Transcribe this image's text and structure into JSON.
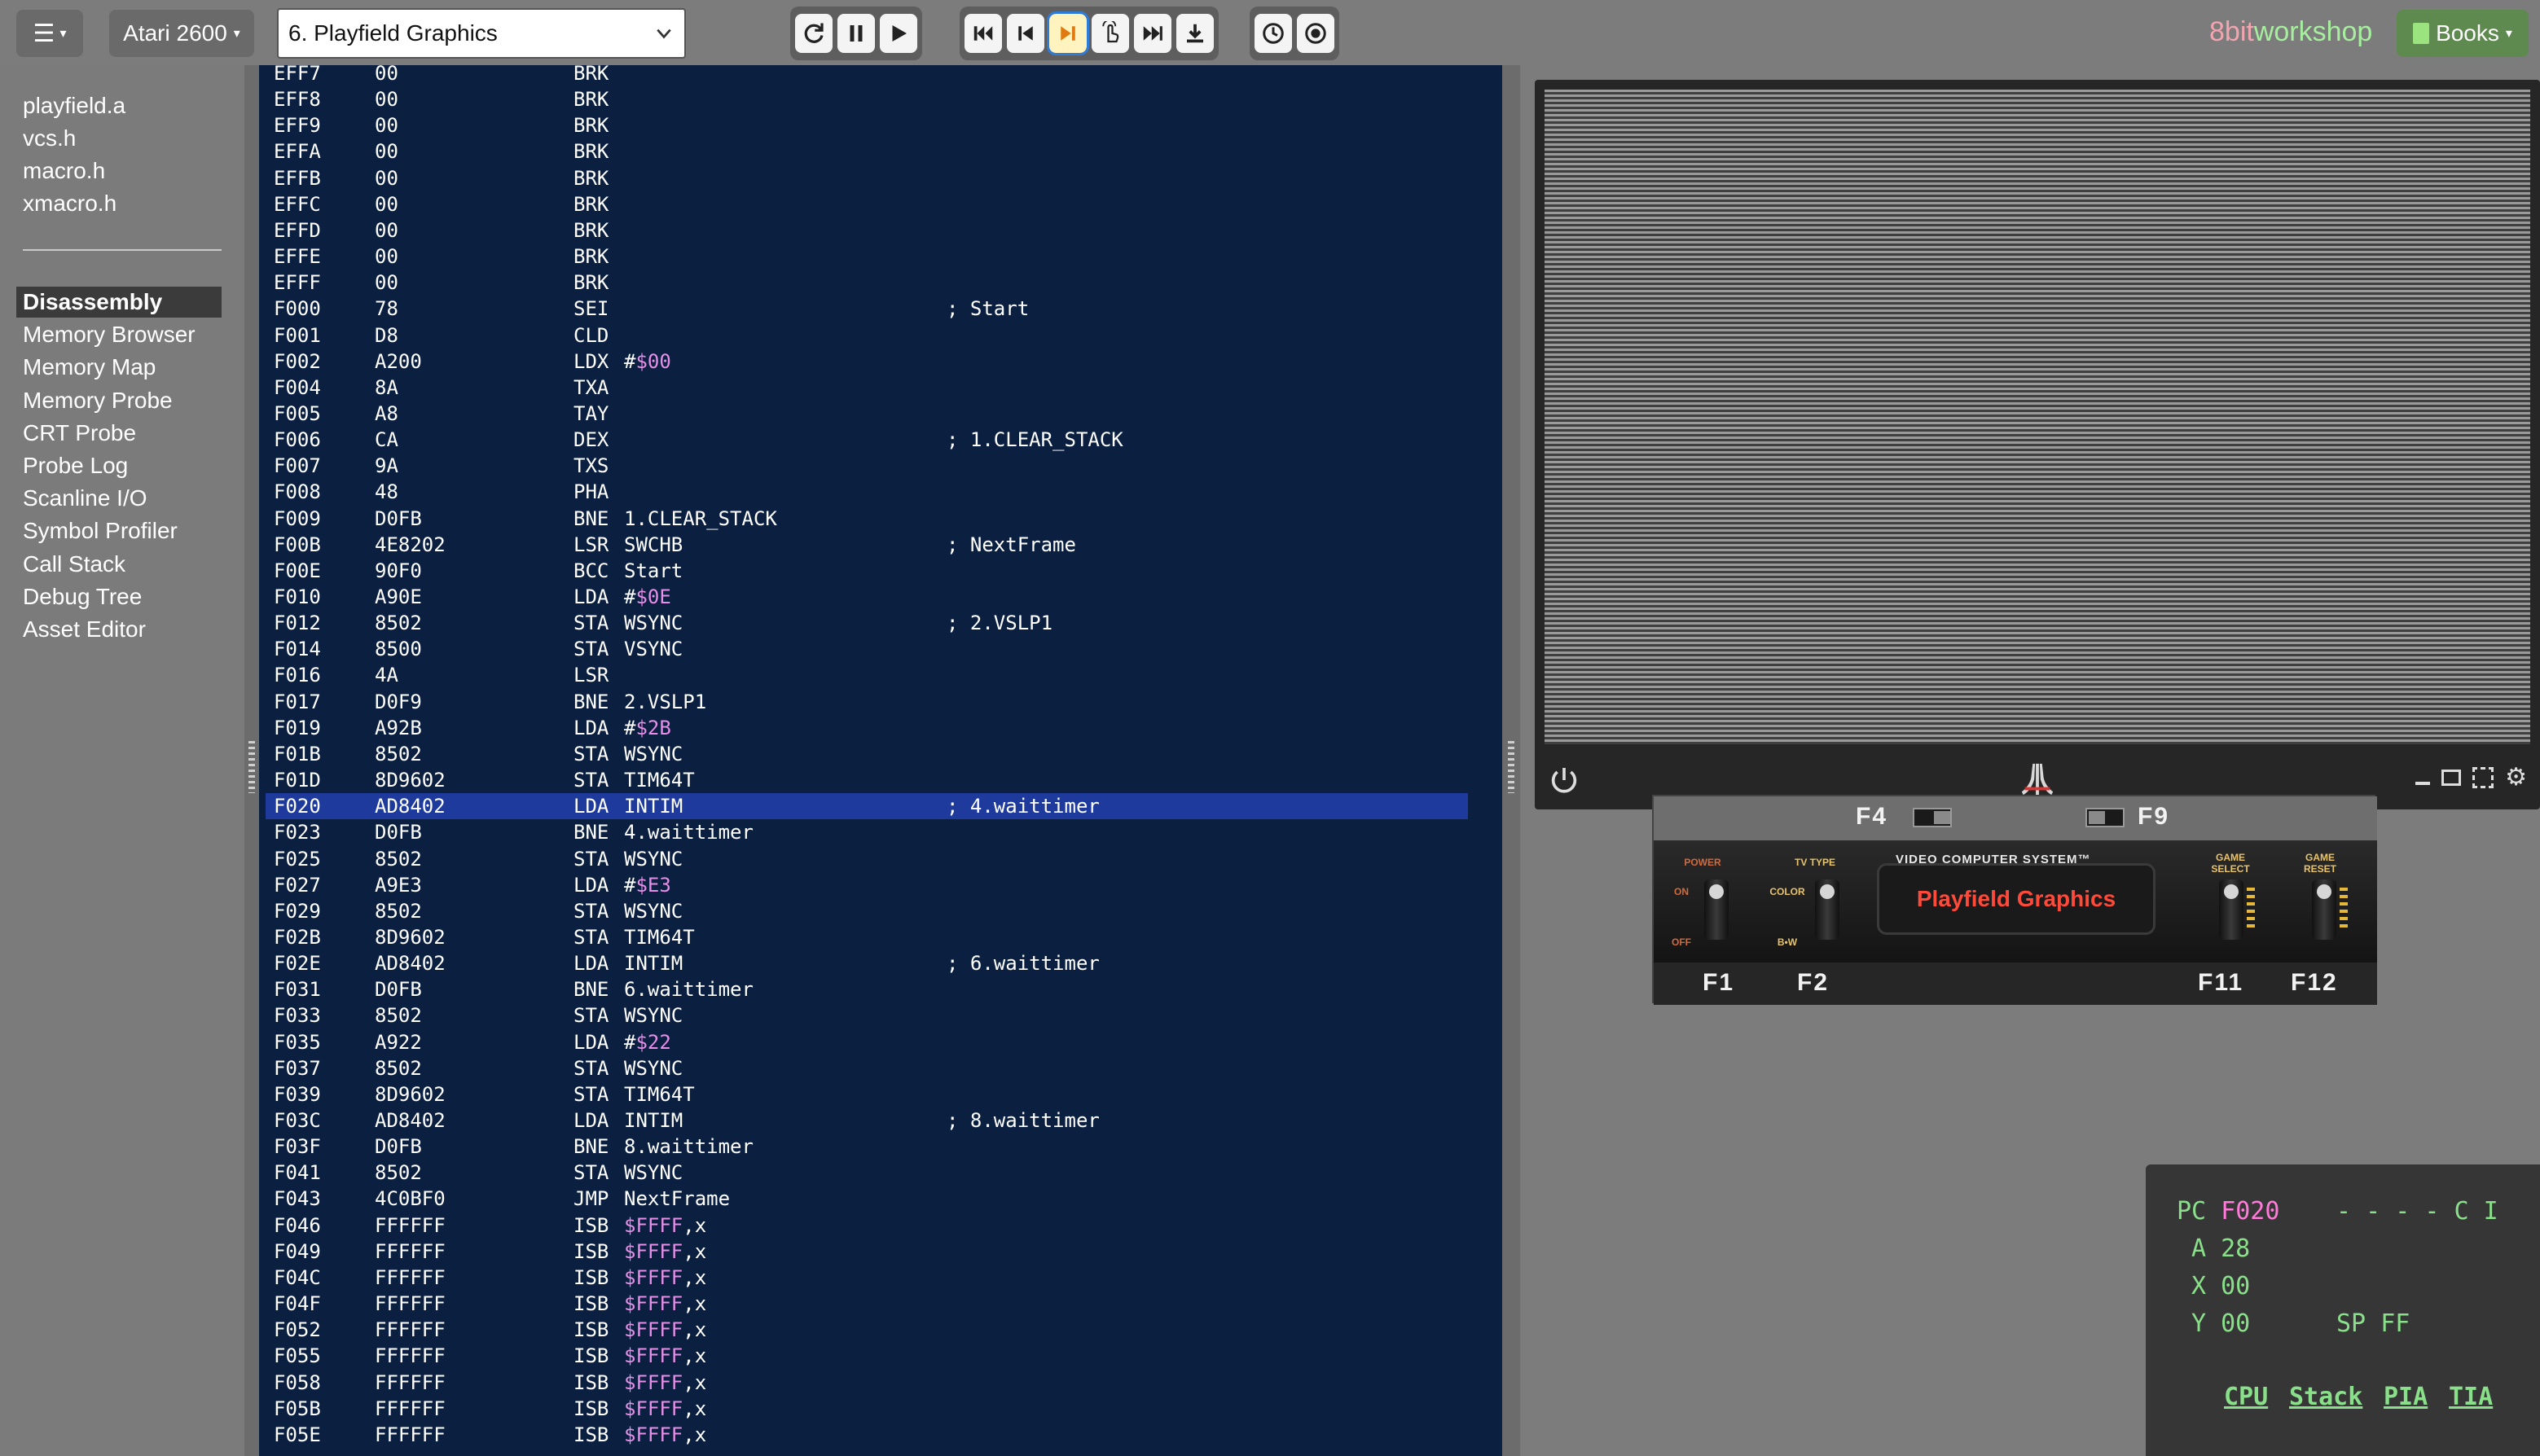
{
  "topbar": {
    "menu_icon": "hamburger-icon",
    "platform": "Atari 2600",
    "preset": "6. Playfield Graphics",
    "buttons_run": [
      "reset-icon",
      "pause-icon",
      "play-icon"
    ],
    "buttons_step": [
      "rewind-start-icon",
      "step-back-icon",
      "step-over-icon",
      "step-cursor-icon",
      "fast-forward-icon",
      "download-icon"
    ],
    "buttons_misc": [
      "clock-icon",
      "record-icon"
    ],
    "brand_a": "8bit",
    "brand_b": "workshop",
    "books": "Books"
  },
  "sidebar": {
    "files": [
      "playfield.a",
      "vcs.h",
      "macro.h",
      "xmacro.h"
    ],
    "views": [
      "Disassembly",
      "Memory Browser",
      "Memory Map",
      "Memory Probe",
      "CRT Probe",
      "Probe Log",
      "Scanline I/O",
      "Symbol Profiler",
      "Call Stack",
      "Debug Tree",
      "Asset Editor"
    ],
    "selected_view": "Disassembly"
  },
  "disassembly": {
    "highlight_index": 28,
    "rows": [
      {
        "addr": "EFF7",
        "hex": "00",
        "op": "BRK",
        "arg": "",
        "lit": "",
        "suffix": "",
        "comment": ""
      },
      {
        "addr": "EFF8",
        "hex": "00",
        "op": "BRK",
        "arg": "",
        "lit": "",
        "suffix": "",
        "comment": ""
      },
      {
        "addr": "EFF9",
        "hex": "00",
        "op": "BRK",
        "arg": "",
        "lit": "",
        "suffix": "",
        "comment": ""
      },
      {
        "addr": "EFFA",
        "hex": "00",
        "op": "BRK",
        "arg": "",
        "lit": "",
        "suffix": "",
        "comment": ""
      },
      {
        "addr": "EFFB",
        "hex": "00",
        "op": "BRK",
        "arg": "",
        "lit": "",
        "suffix": "",
        "comment": ""
      },
      {
        "addr": "EFFC",
        "hex": "00",
        "op": "BRK",
        "arg": "",
        "lit": "",
        "suffix": "",
        "comment": ""
      },
      {
        "addr": "EFFD",
        "hex": "00",
        "op": "BRK",
        "arg": "",
        "lit": "",
        "suffix": "",
        "comment": ""
      },
      {
        "addr": "EFFE",
        "hex": "00",
        "op": "BRK",
        "arg": "",
        "lit": "",
        "suffix": "",
        "comment": ""
      },
      {
        "addr": "EFFF",
        "hex": "00",
        "op": "BRK",
        "arg": "",
        "lit": "",
        "suffix": "",
        "comment": ""
      },
      {
        "addr": "F000",
        "hex": "78",
        "op": "SEI",
        "arg": "",
        "lit": "",
        "suffix": "",
        "comment": "; Start"
      },
      {
        "addr": "F001",
        "hex": "D8",
        "op": "CLD",
        "arg": "",
        "lit": "",
        "suffix": "",
        "comment": ""
      },
      {
        "addr": "F002",
        "hex": "A200",
        "op": "LDX",
        "arg": "#",
        "lit": "$00",
        "suffix": "",
        "comment": ""
      },
      {
        "addr": "F004",
        "hex": "8A",
        "op": "TXA",
        "arg": "",
        "lit": "",
        "suffix": "",
        "comment": ""
      },
      {
        "addr": "F005",
        "hex": "A8",
        "op": "TAY",
        "arg": "",
        "lit": "",
        "suffix": "",
        "comment": ""
      },
      {
        "addr": "F006",
        "hex": "CA",
        "op": "DEX",
        "arg": "",
        "lit": "",
        "suffix": "",
        "comment": "; 1.CLEAR_STACK"
      },
      {
        "addr": "F007",
        "hex": "9A",
        "op": "TXS",
        "arg": "",
        "lit": "",
        "suffix": "",
        "comment": ""
      },
      {
        "addr": "F008",
        "hex": "48",
        "op": "PHA",
        "arg": "",
        "lit": "",
        "suffix": "",
        "comment": ""
      },
      {
        "addr": "F009",
        "hex": "D0FB",
        "op": "BNE",
        "arg": "1.CLEAR_STACK",
        "lit": "",
        "suffix": "",
        "comment": ""
      },
      {
        "addr": "F00B",
        "hex": "4E8202",
        "op": "LSR",
        "arg": "SWCHB",
        "lit": "",
        "suffix": "",
        "comment": "; NextFrame"
      },
      {
        "addr": "F00E",
        "hex": "90F0",
        "op": "BCC",
        "arg": "Start",
        "lit": "",
        "suffix": "",
        "comment": ""
      },
      {
        "addr": "F010",
        "hex": "A90E",
        "op": "LDA",
        "arg": "#",
        "lit": "$0E",
        "suffix": "",
        "comment": ""
      },
      {
        "addr": "F012",
        "hex": "8502",
        "op": "STA",
        "arg": "WSYNC",
        "lit": "",
        "suffix": "",
        "comment": "; 2.VSLP1"
      },
      {
        "addr": "F014",
        "hex": "8500",
        "op": "STA",
        "arg": "VSYNC",
        "lit": "",
        "suffix": "",
        "comment": ""
      },
      {
        "addr": "F016",
        "hex": "4A",
        "op": "LSR",
        "arg": "",
        "lit": "",
        "suffix": "",
        "comment": ""
      },
      {
        "addr": "F017",
        "hex": "D0F9",
        "op": "BNE",
        "arg": "2.VSLP1",
        "lit": "",
        "suffix": "",
        "comment": ""
      },
      {
        "addr": "F019",
        "hex": "A92B",
        "op": "LDA",
        "arg": "#",
        "lit": "$2B",
        "suffix": "",
        "comment": ""
      },
      {
        "addr": "F01B",
        "hex": "8502",
        "op": "STA",
        "arg": "WSYNC",
        "lit": "",
        "suffix": "",
        "comment": ""
      },
      {
        "addr": "F01D",
        "hex": "8D9602",
        "op": "STA",
        "arg": "TIM64T",
        "lit": "",
        "suffix": "",
        "comment": ""
      },
      {
        "addr": "F020",
        "hex": "AD8402",
        "op": "LDA",
        "arg": "INTIM",
        "lit": "",
        "suffix": "",
        "comment": "; 4.waittimer"
      },
      {
        "addr": "F023",
        "hex": "D0FB",
        "op": "BNE",
        "arg": "4.waittimer",
        "lit": "",
        "suffix": "",
        "comment": ""
      },
      {
        "addr": "F025",
        "hex": "8502",
        "op": "STA",
        "arg": "WSYNC",
        "lit": "",
        "suffix": "",
        "comment": ""
      },
      {
        "addr": "F027",
        "hex": "A9E3",
        "op": "LDA",
        "arg": "#",
        "lit": "$E3",
        "suffix": "",
        "comment": ""
      },
      {
        "addr": "F029",
        "hex": "8502",
        "op": "STA",
        "arg": "WSYNC",
        "lit": "",
        "suffix": "",
        "comment": ""
      },
      {
        "addr": "F02B",
        "hex": "8D9602",
        "op": "STA",
        "arg": "TIM64T",
        "lit": "",
        "suffix": "",
        "comment": ""
      },
      {
        "addr": "F02E",
        "hex": "AD8402",
        "op": "LDA",
        "arg": "INTIM",
        "lit": "",
        "suffix": "",
        "comment": "; 6.waittimer"
      },
      {
        "addr": "F031",
        "hex": "D0FB",
        "op": "BNE",
        "arg": "6.waittimer",
        "lit": "",
        "suffix": "",
        "comment": ""
      },
      {
        "addr": "F033",
        "hex": "8502",
        "op": "STA",
        "arg": "WSYNC",
        "lit": "",
        "suffix": "",
        "comment": ""
      },
      {
        "addr": "F035",
        "hex": "A922",
        "op": "LDA",
        "arg": "#",
        "lit": "$22",
        "suffix": "",
        "comment": ""
      },
      {
        "addr": "F037",
        "hex": "8502",
        "op": "STA",
        "arg": "WSYNC",
        "lit": "",
        "suffix": "",
        "comment": ""
      },
      {
        "addr": "F039",
        "hex": "8D9602",
        "op": "STA",
        "arg": "TIM64T",
        "lit": "",
        "suffix": "",
        "comment": ""
      },
      {
        "addr": "F03C",
        "hex": "AD8402",
        "op": "LDA",
        "arg": "INTIM",
        "lit": "",
        "suffix": "",
        "comment": "; 8.waittimer"
      },
      {
        "addr": "F03F",
        "hex": "D0FB",
        "op": "BNE",
        "arg": "8.waittimer",
        "lit": "",
        "suffix": "",
        "comment": ""
      },
      {
        "addr": "F041",
        "hex": "8502",
        "op": "STA",
        "arg": "WSYNC",
        "lit": "",
        "suffix": "",
        "comment": ""
      },
      {
        "addr": "F043",
        "hex": "4C0BF0",
        "op": "JMP",
        "arg": "NextFrame",
        "lit": "",
        "suffix": "",
        "comment": ""
      },
      {
        "addr": "F046",
        "hex": "FFFFFF",
        "op": "ISB",
        "arg": "",
        "lit": "$FFFF",
        "suffix": ",x",
        "comment": ""
      },
      {
        "addr": "F049",
        "hex": "FFFFFF",
        "op": "ISB",
        "arg": "",
        "lit": "$FFFF",
        "suffix": ",x",
        "comment": ""
      },
      {
        "addr": "F04C",
        "hex": "FFFFFF",
        "op": "ISB",
        "arg": "",
        "lit": "$FFFF",
        "suffix": ",x",
        "comment": ""
      },
      {
        "addr": "F04F",
        "hex": "FFFFFF",
        "op": "ISB",
        "arg": "",
        "lit": "$FFFF",
        "suffix": ",x",
        "comment": ""
      },
      {
        "addr": "F052",
        "hex": "FFFFFF",
        "op": "ISB",
        "arg": "",
        "lit": "$FFFF",
        "suffix": ",x",
        "comment": ""
      },
      {
        "addr": "F055",
        "hex": "FFFFFF",
        "op": "ISB",
        "arg": "",
        "lit": "$FFFF",
        "suffix": ",x",
        "comment": ""
      },
      {
        "addr": "F058",
        "hex": "FFFFFF",
        "op": "ISB",
        "arg": "",
        "lit": "$FFFF",
        "suffix": ",x",
        "comment": ""
      },
      {
        "addr": "F05B",
        "hex": "FFFFFF",
        "op": "ISB",
        "arg": "",
        "lit": "$FFFF",
        "suffix": ",x",
        "comment": ""
      },
      {
        "addr": "F05E",
        "hex": "FFFFFF",
        "op": "ISB",
        "arg": "",
        "lit": "$FFFF",
        "suffix": ",x",
        "comment": ""
      }
    ]
  },
  "emulator": {
    "screen_tools": [
      "minimize-icon",
      "window-icon",
      "fullscreen-icon",
      "gear-icon"
    ],
    "console": {
      "f4": "F4",
      "f9": "F9",
      "power_label": "POWER",
      "on_label": "ON",
      "off_label": "OFF",
      "tvtype_label": "TV TYPE",
      "color_label": "COLOR",
      "bw_label": "B•W",
      "vcs_label": "VIDEO COMPUTER SYSTEM™",
      "cart_title": "Playfield Graphics",
      "select_label": "GAME SELECT",
      "reset_label": "GAME RESET",
      "f1": "F1",
      "f2": "F2",
      "f11": "F11",
      "f12": "F12"
    }
  },
  "cpu": {
    "pc_label": "PC",
    "pc": "F020",
    "a_label": "A",
    "a": "28",
    "x_label": "X",
    "x": "00",
    "y_label": "Y",
    "y": "00",
    "flags": "- - - - C I",
    "sp_label": "SP",
    "sp": "FF",
    "tabs": [
      "CPU",
      "Stack",
      "PIA",
      "TIA"
    ]
  },
  "colors": {
    "disasm_bg": "#0b2040",
    "highlight": "#1d3a9c",
    "literal": "#e88ee8",
    "cpu_text": "#8ae08a",
    "pc_value": "#ff7ad9",
    "brand_pink": "#f0a5b0",
    "brand_green": "#a7ee9f"
  }
}
